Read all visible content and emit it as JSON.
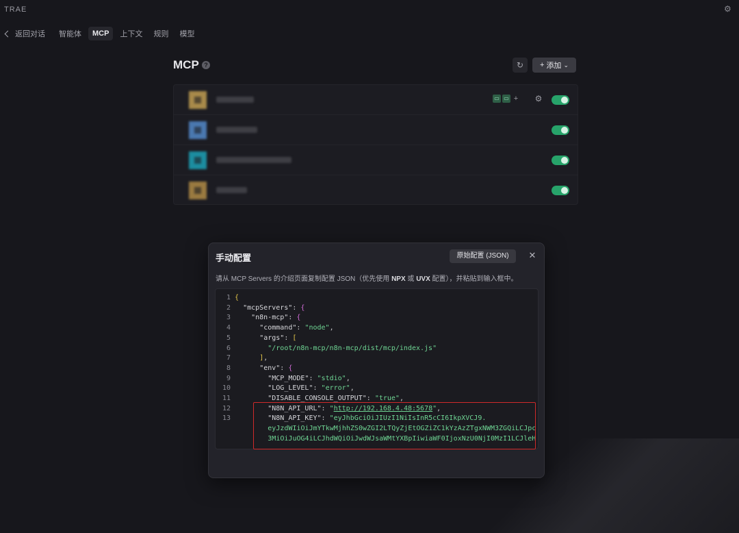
{
  "app": {
    "title": "TRAE",
    "settings_icon": "gear-icon"
  },
  "nav": {
    "back_label": "返回对话",
    "tabs": [
      {
        "label": "智能体",
        "active": false
      },
      {
        "label": "MCP",
        "active": true
      },
      {
        "label": "上下文",
        "active": false
      },
      {
        "label": "规则",
        "active": false
      },
      {
        "label": "模型",
        "active": false
      }
    ]
  },
  "mcp": {
    "title": "MCP",
    "add_label": "添加",
    "servers": [
      {
        "icon_color": "#a88a4a",
        "name_width": "blurred",
        "enabled": true
      },
      {
        "icon_color": "#4a78b0",
        "name_width": "blurred",
        "enabled": true
      },
      {
        "icon_color": "#1c8da0",
        "name_width": "blurred",
        "enabled": true
      },
      {
        "icon_color": "#9a7a40",
        "name_width": "blurred",
        "enabled": true
      }
    ]
  },
  "dialog": {
    "title": "手动配置",
    "json_button": "原始配置 (JSON)",
    "close_icon": "close-icon",
    "description_parts": [
      "请从 MCP Servers 的介绍页面复制配置 JSON（优先使用 ",
      "NPX",
      " 或 ",
      "UVX",
      " 配置），并粘贴到输入框中。"
    ]
  },
  "code": {
    "lines": [
      {
        "n": "1",
        "t": "{"
      },
      {
        "n": "2",
        "t": "  \"mcpServers\": {"
      },
      {
        "n": "3",
        "t": "    \"n8n-mcp\": {"
      },
      {
        "n": "4",
        "t": "      \"command\": \"node\","
      },
      {
        "n": "5",
        "t": "      \"args\": ["
      },
      {
        "n": "6",
        "t": "        \"/root/n8n-mcp/n8n-mcp/dist/mcp/index.js\""
      },
      {
        "n": "7",
        "t": "      ],"
      },
      {
        "n": "8",
        "t": "      \"env\": {"
      },
      {
        "n": "9",
        "t": "        \"MCP_MODE\": \"stdio\","
      },
      {
        "n": "10",
        "t": "        \"LOG_LEVEL\": \"error\","
      },
      {
        "n": "11",
        "t": "        \"DISABLE_CONSOLE_OUTPUT\": \"true\","
      },
      {
        "n": "12",
        "t": "        \"N8N_API_URL\": \"http://192.168.4.48:5678\","
      },
      {
        "n": "13",
        "t": "        \"N8N_API_KEY\": \"eyJhbGciOiJIUzI1NiIsInR5cCI6IkpXVCJ9."
      },
      {
        "n": "",
        "t": "        eyJzdWIiOiJmYTkwMjhhZS0wZGI2LTQyZjEtOGZiZC1kYzAzZTgxNWM3ZGQiLCJpc"
      },
      {
        "n": "",
        "t": "        3MiOiJuOG4iLCJhdWQiOiJwdWJsaWMtYXBpIiwiaWF0IjoxNzU0NjI0MzI1LCJleH"
      }
    ]
  }
}
